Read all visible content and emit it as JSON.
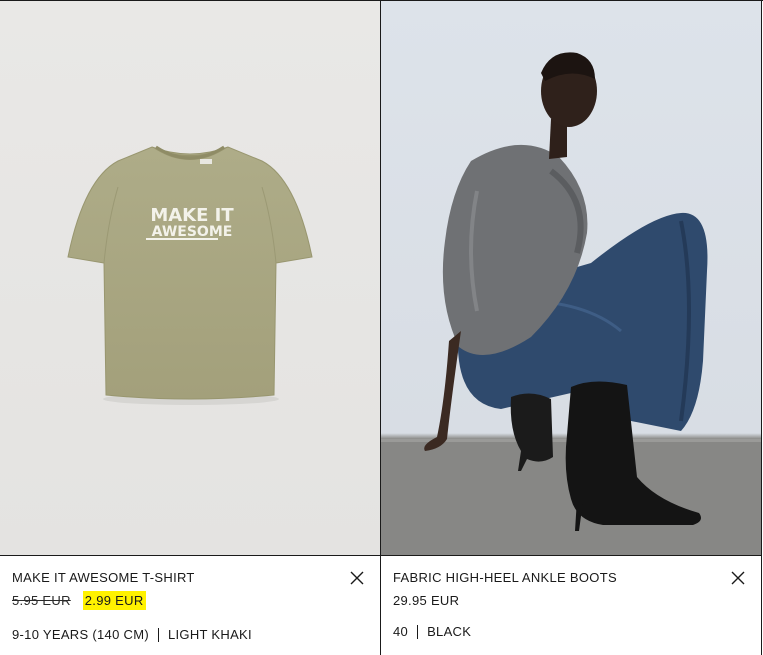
{
  "products": [
    {
      "name": "MAKE IT AWESOME T-SHIRT",
      "price_old": "5.95 EUR",
      "price_current": "2.99 EUR",
      "size": "9-10 YEARS (140 CM)",
      "color": "LIGHT KHAKI",
      "print_line1": "MAKE IT",
      "print_line2": "AWESOME",
      "icon": "close-icon"
    },
    {
      "name": "FABRIC HIGH-HEEL ANKLE BOOTS",
      "price_current": "29.95 EUR",
      "size": "40",
      "color": "BLACK",
      "icon": "close-icon"
    }
  ],
  "colors": {
    "sale_highlight": "#fff200",
    "border": "#1a1a1a",
    "shirt": "#a9a783"
  }
}
